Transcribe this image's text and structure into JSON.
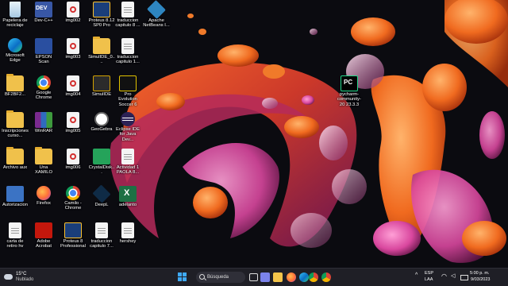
{
  "desktop": {
    "icons": [
      {
        "label": "Papelera de reciclaje",
        "icon": "recycle-bin-icon",
        "kind": "bin"
      },
      {
        "label": "Dev-C++",
        "icon": "devcpp-icon",
        "kind": "devcpp"
      },
      {
        "label": "img002",
        "icon": "pdf-file-icon",
        "kind": "pdf"
      },
      {
        "label": "Proteus 8.12 SP0 Pro",
        "icon": "proteus-icon",
        "kind": "proteus"
      },
      {
        "label": "traduccion capitulo 8 ...",
        "icon": "document-icon",
        "kind": "doc"
      },
      {
        "label": "Apache NetBeans I...",
        "icon": "netbeans-icon",
        "kind": "netbeans"
      },
      {
        "label": "Microsoft Edge",
        "icon": "edge-icon",
        "kind": "edge"
      },
      {
        "label": "EPSON Scan",
        "icon": "epson-scan-icon",
        "kind": "epson"
      },
      {
        "label": "img003",
        "icon": "pdf-file-icon",
        "kind": "pdf"
      },
      {
        "label": "SimulIDE_0....",
        "icon": "folder-icon",
        "kind": "folder"
      },
      {
        "label": "traduccion capitulo 1...",
        "icon": "document-icon",
        "kind": "doc"
      },
      {
        "label": "BF2BF2...",
        "icon": "folder-icon",
        "kind": "folder"
      },
      {
        "label": "Google Chrome",
        "icon": "chrome-icon",
        "kind": "chrome"
      },
      {
        "label": "img004",
        "icon": "pdf-file-icon",
        "kind": "pdf"
      },
      {
        "label": "SimulIDE",
        "icon": "simulide-icon",
        "kind": "simulide"
      },
      {
        "label": "Pro Evolution Soccer 6",
        "icon": "pes-icon",
        "kind": "pes"
      },
      {
        "label": "Inscripciones curso...",
        "icon": "folder-icon",
        "kind": "folder"
      },
      {
        "label": "WinRAR",
        "icon": "winrar-icon",
        "kind": "winrar"
      },
      {
        "label": "img005",
        "icon": "pdf-file-icon",
        "kind": "pdf"
      },
      {
        "label": "GeoGebra",
        "icon": "geogebra-icon",
        "kind": "geogebra"
      },
      {
        "label": "Eclipse IDE for Java Dev...",
        "icon": "eclipse-icon",
        "kind": "eclipse"
      },
      {
        "label": "Archivo aux",
        "icon": "folder-icon",
        "kind": "folder"
      },
      {
        "label": "Una XAMILO",
        "icon": "folder-icon",
        "kind": "folder"
      },
      {
        "label": "img006",
        "icon": "pdf-file-icon",
        "kind": "pdf"
      },
      {
        "label": "CrystalDisk...",
        "icon": "crystaldisk-icon",
        "kind": "crystal"
      },
      {
        "label": "Actividad 1 PAOLA 8...",
        "icon": "document-icon",
        "kind": "doc"
      },
      {
        "label": "Autorizacion",
        "icon": "document-icon",
        "kind": "auto"
      },
      {
        "label": "Firefox",
        "icon": "firefox-icon",
        "kind": "firefox"
      },
      {
        "label": "Camilo - Chrome",
        "icon": "chrome-icon",
        "kind": "chrome"
      },
      {
        "label": "DeepL",
        "icon": "deepl-icon",
        "kind": "deepl"
      },
      {
        "label": "adelanto",
        "icon": "excel-icon",
        "kind": "excel"
      },
      {
        "label": "carta de retiro hv",
        "icon": "document-icon",
        "kind": "doc"
      },
      {
        "label": "Adobe Acrobat",
        "icon": "acrobat-icon",
        "kind": "acrobat"
      },
      {
        "label": "Proteus 8 Professional",
        "icon": "proteus-icon",
        "kind": "proteus"
      },
      {
        "label": "traduccion capitulo 7...",
        "icon": "document-icon",
        "kind": "doc"
      },
      {
        "label": "hershey",
        "icon": "document-icon",
        "kind": "doc"
      },
      {
        "label": "pycharm-community-20 23.3.3",
        "icon": "pycharm-icon",
        "kind": "pycharm"
      }
    ]
  },
  "taskbar": {
    "weather_temp": "15°C",
    "weather_desc": "Nublado",
    "search_label": "Búsqueda",
    "language_line1": "ESP",
    "language_line2": "LAA",
    "time": "5:00 p. m.",
    "date": "9/03/2023",
    "colors": {
      "background": "#1f1f26",
      "start_blue": "#3fa9f5"
    }
  }
}
